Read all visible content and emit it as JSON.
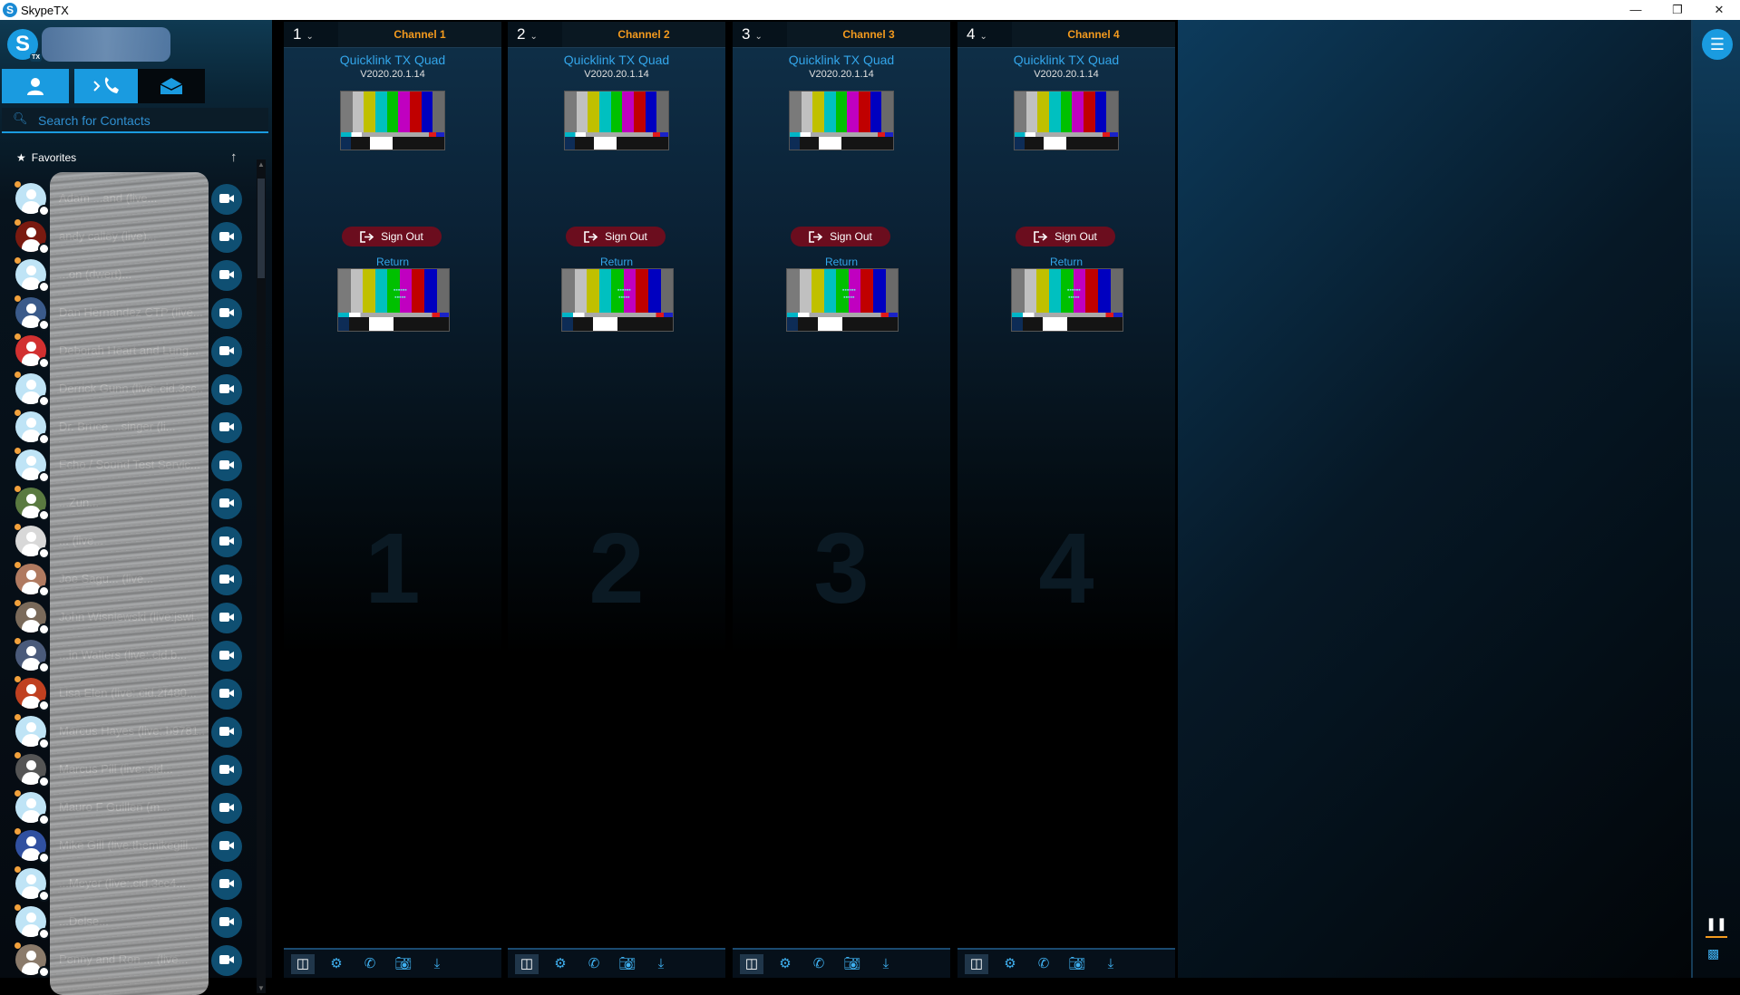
{
  "window": {
    "title": "SkypeTX",
    "minimize": "—",
    "restore": "❐",
    "close": "✕"
  },
  "sidebar": {
    "search_placeholder": "Search for Contacts",
    "favorites_label": "Favorites",
    "contacts": [
      {
        "name": "Adam ...and (live..."
      },
      {
        "name": "andy calley (live)..."
      },
      {
        "name": "...on (dwert)..."
      },
      {
        "name": "Dan Hernandez CTP (live..."
      },
      {
        "name": "Deborah Heart and Lung..."
      },
      {
        "name": "Derrick Gunn (live:.cid.3cc..."
      },
      {
        "name": "Dr. Bruce ...singer (li..."
      },
      {
        "name": "Echo / Sound Test Servic..."
      },
      {
        "name": "...Zun..."
      },
      {
        "name": "... (live..."
      },
      {
        "name": "Joe Sagu... (live..."
      },
      {
        "name": "John Wisniewski (live:jswi..."
      },
      {
        "name": "...in Walters (live:.cid.b..."
      },
      {
        "name": "Lisa Elen (live:.cid.2f480..."
      },
      {
        "name": "Marcus Hayes (live:.b9781..."
      },
      {
        "name": "Marcus Pill (live:.cid..."
      },
      {
        "name": "Mauro F Guillen (m..."
      },
      {
        "name": "Mike Gill (live:themikegill..."
      },
      {
        "name": "...Meyer (live:.cid.3cc4..."
      },
      {
        "name": "...Delse..."
      },
      {
        "name": "Penny and Ron ... (live..."
      }
    ]
  },
  "channels": [
    {
      "number": "1",
      "name": "Channel 1",
      "product": "Quicklink TX Quad",
      "version": "V2020.20.1.14",
      "signout": "Sign Out",
      "return_label": "Return",
      "watermark": "1"
    },
    {
      "number": "2",
      "name": "Channel 2",
      "product": "Quicklink TX Quad",
      "version": "V2020.20.1.14",
      "signout": "Sign Out",
      "return_label": "Return",
      "watermark": "2"
    },
    {
      "number": "3",
      "name": "Channel 3",
      "product": "Quicklink TX Quad",
      "version": "V2020.20.1.14",
      "signout": "Sign Out",
      "return_label": "Return",
      "watermark": "3"
    },
    {
      "number": "4",
      "name": "Channel 4",
      "product": "Quicklink TX Quad",
      "version": "V2020.20.1.14",
      "signout": "Sign Out",
      "return_label": "Return",
      "watermark": "4"
    }
  ],
  "colors": {
    "accent": "#1a9be0",
    "channel_name": "#f39a1e",
    "signout_bg": "#6b0d1e",
    "bars": [
      "#c0c0c0",
      "#c0c000",
      "#00c0c0",
      "#00c000",
      "#c000c0",
      "#c00000",
      "#0000c0"
    ]
  },
  "icons": {
    "contacts_tab": "person-icon",
    "calls_tab": "phone-icon",
    "messages_tab": "envelope-icon"
  }
}
